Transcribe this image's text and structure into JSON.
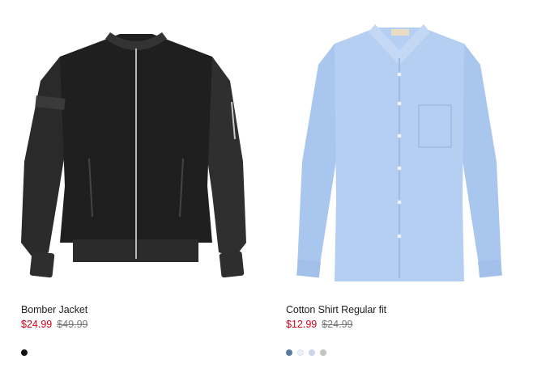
{
  "products": [
    {
      "name": "Bomber Jacket",
      "sale_price": "$24.99",
      "original_price": "$49.99",
      "swatches": [
        "#111111"
      ]
    },
    {
      "name": "Cotton Shirt Regular fit",
      "sale_price": "$12.99",
      "original_price": "$24.99",
      "swatches": [
        "#5b7c9e",
        "#eef2f8",
        "#c9d6ee",
        "#c4c4c4"
      ]
    }
  ]
}
